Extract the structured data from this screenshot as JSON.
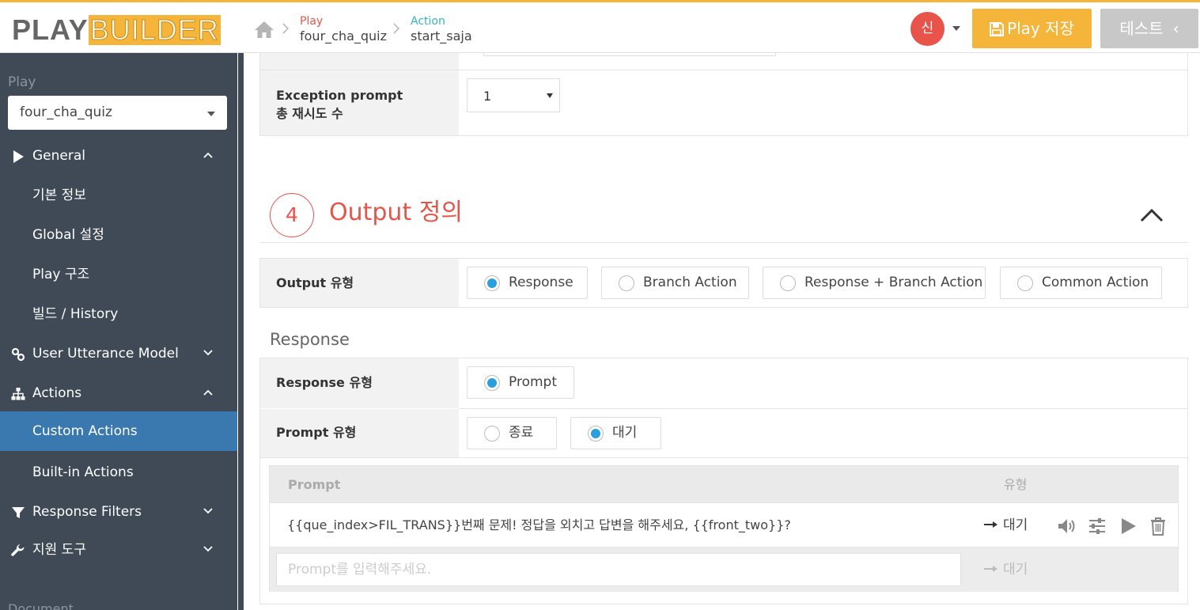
{
  "header": {
    "logo_play": "PLAY",
    "logo_builder": "BUILDER",
    "crumbs": [
      {
        "label": "Play",
        "value": "four_cha_quiz"
      },
      {
        "label": "Action",
        "value": "start_saja"
      }
    ],
    "avatar": "신",
    "save_label": "Play 저장",
    "test_label": "테스트"
  },
  "sidebar": {
    "play_label": "Play",
    "play_selected": "four_cha_quiz",
    "items": [
      {
        "label": "General"
      },
      {
        "label": "기본 정보"
      },
      {
        "label": "Global 설정"
      },
      {
        "label": "Play 구조"
      },
      {
        "label": "빌드 / History"
      },
      {
        "label": "User Utterance Model"
      },
      {
        "label": "Actions"
      },
      {
        "label": "Custom Actions"
      },
      {
        "label": "Built-in Actions"
      },
      {
        "label": "Response Filters"
      },
      {
        "label": "지원 도구"
      }
    ],
    "doc_label": "Document"
  },
  "main": {
    "exception": {
      "label_line1": "Exception prompt",
      "label_line2": "총 재시도 수",
      "value": "1"
    },
    "section": {
      "number": "4",
      "title": "Output 정의"
    },
    "output_type": {
      "label": "Output 유형",
      "options": [
        "Response",
        "Branch Action",
        "Response + Branch Action",
        "Common Action"
      ],
      "selected": "Response"
    },
    "response_heading": "Response",
    "response_type": {
      "label": "Response 유형",
      "options": [
        "Prompt"
      ],
      "selected": "Prompt"
    },
    "prompt_type": {
      "label": "Prompt 유형",
      "options": [
        "종료",
        "대기"
      ],
      "selected": "대기"
    },
    "prompt_table": {
      "col_prompt": "Prompt",
      "col_type": "유형",
      "rows": [
        {
          "text": "{{que_index>FIL_TRANS}}번째 문제! 정답을 외치고 답변을 해주세요,  {{front_two}}?",
          "type": "대기"
        }
      ],
      "input_placeholder": "Prompt를 입력해주세요.",
      "input_type": "대기"
    }
  },
  "colors": {
    "accent": "#f5b53a",
    "red": "#e8544a",
    "teal": "#35b5c0",
    "sidebar": "#3f4a56",
    "active": "#3a78b0",
    "radio": "#2a9fe0"
  }
}
